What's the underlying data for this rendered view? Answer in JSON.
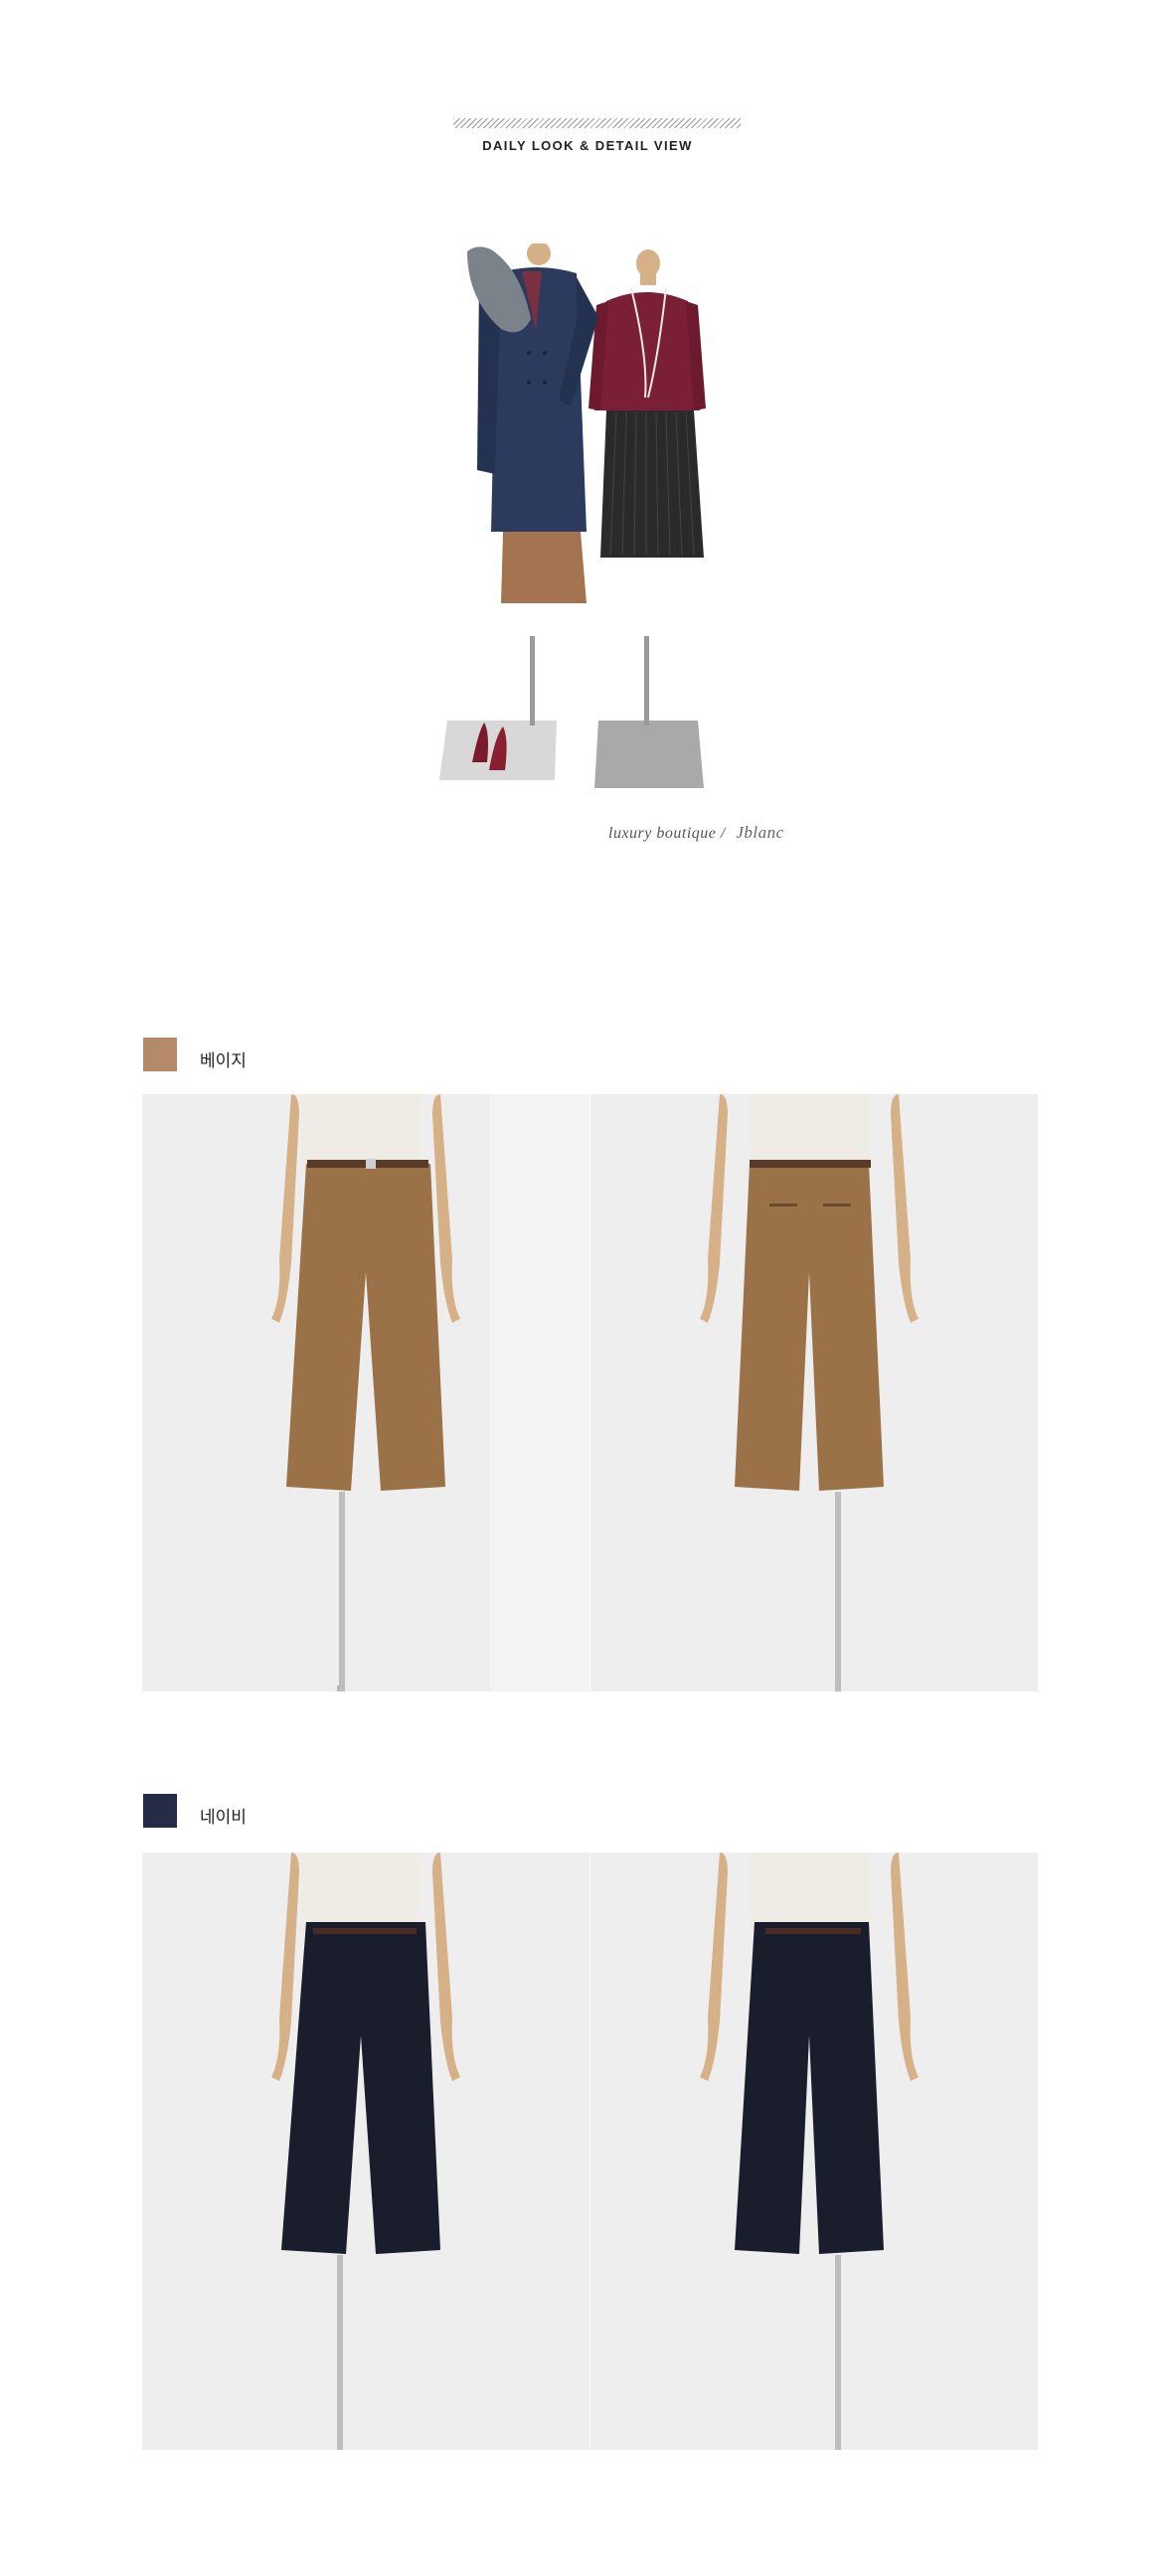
{
  "header": {
    "title": "DAILY LOOK & DETAIL VIEW"
  },
  "signature": {
    "text": "luxury boutique",
    "separator": "/",
    "brand_script": "Jblanc"
  },
  "color_options": [
    {
      "label": "베이지",
      "swatch_color": "#b48a68",
      "pants_color": "#9b7148",
      "photos": [
        {
          "view": "front",
          "icon": "pants-front-photo"
        },
        {
          "view": "back",
          "icon": "pants-back-photo"
        }
      ]
    },
    {
      "label": "네이비",
      "swatch_color": "#262b48",
      "pants_color": "#191d2c",
      "photos": [
        {
          "view": "front",
          "icon": "pants-front-photo"
        },
        {
          "view": "back",
          "icon": "pants-back-photo"
        }
      ]
    }
  ],
  "colors": {
    "background": "#ffffff",
    "photo_background": "#efefef",
    "mannequin_skin": "#d6b187",
    "coat_navy": "#2c3a5e",
    "sweater_burgundy": "#7a1f35",
    "skirt_black": "#2a2a2a",
    "fur_gray": "#7b828a"
  }
}
